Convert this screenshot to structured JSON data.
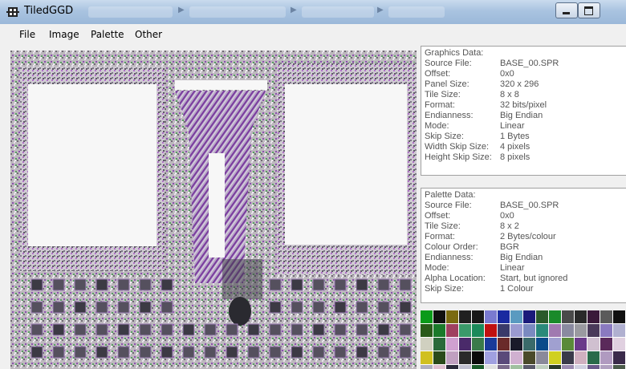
{
  "window": {
    "title": "TiledGGD"
  },
  "menu": [
    "File",
    "Image",
    "Palette",
    "Other"
  ],
  "graphics_panel": {
    "title": "Graphics Data:",
    "rows": [
      {
        "label": "Source File:",
        "value": "BASE_00.SPR"
      },
      {
        "label": "Offset:",
        "value": "0x0"
      },
      {
        "label": "Panel Size:",
        "value": "320 x 296"
      },
      {
        "label": "Tile Size:",
        "value": "8 x 8"
      },
      {
        "label": "Format:",
        "value": "32 bits/pixel"
      },
      {
        "label": "Endianness:",
        "value": "Big Endian"
      },
      {
        "label": "Mode:",
        "value": "Linear"
      },
      {
        "label": "Skip Size:",
        "value": "1 Bytes"
      },
      {
        "label": "Width Skip Size:",
        "value": "4 pixels"
      },
      {
        "label": "Height Skip Size:",
        "value": "8 pixels"
      }
    ]
  },
  "palette_panel": {
    "title": "Palette Data:",
    "rows": [
      {
        "label": "Source File:",
        "value": "BASE_00.SPR"
      },
      {
        "label": "Offset:",
        "value": "0x0"
      },
      {
        "label": "Tile Size:",
        "value": "8 x 2"
      },
      {
        "label": "Format:",
        "value": "2 Bytes/colour"
      },
      {
        "label": "Colour Order:",
        "value": "BGR"
      },
      {
        "label": "Endianness:",
        "value": "Big Endian"
      },
      {
        "label": "Mode:",
        "value": "Linear"
      },
      {
        "label": "Alpha Location:",
        "value": "Start, but ignored"
      },
      {
        "label": "Skip Size:",
        "value": "1 Colour"
      }
    ]
  },
  "palette_colors": [
    "#0a9a1a",
    "#101010",
    "#7a6a10",
    "#202020",
    "#181818",
    "#7a7ad0",
    "#1a2aa0",
    "#5a9ac0",
    "#1a1a7a",
    "#2a5a2a",
    "#1a8a2a",
    "#4a4a4a",
    "#2a2a2a",
    "#3a1a3a",
    "#5a5a5a",
    "#101010",
    "#2a5a1a",
    "#1a7a2a",
    "#a04060",
    "#3a9a6a",
    "#1a8a5a",
    "#c01010",
    "#3a3a6a",
    "#9a9ad0",
    "#7a8ac0",
    "#2a8a7a",
    "#a07ab0",
    "#8a8aa0",
    "#9a9aa0",
    "#4a3a5a",
    "#8a7ac0",
    "#b0b0d0",
    "#d0d0c0",
    "#2a6a3a",
    "#d0a0d0",
    "#4a2a6a",
    "#3a7a4a",
    "#1a3a9a",
    "#6a2a2a",
    "#1a1a2a",
    "#3a6a6a",
    "#0a4a8a",
    "#a0a0d0",
    "#5a8a3a",
    "#6a3a8a",
    "#d0c0d0",
    "#5a2a5a",
    "#e0d0e0",
    "#d0c020",
    "#2a4a1a",
    "#c0a0c0",
    "#2a2a2a",
    "#0a0a0a",
    "#a0a0e0",
    "#5a4a7a",
    "#d0b0d0",
    "#4a4a2a",
    "#8a8a9a",
    "#d0d020",
    "#3a3a4a",
    "#d0b0c0",
    "#2a6a4a",
    "#b09ac0",
    "#3a2a4a",
    "#b0b0c0",
    "#e0c0d0",
    "#2a2a3a",
    "#c0c0d0",
    "#1a5a2a",
    "#e0e0e0",
    "#7a6a8a",
    "#a0c0a0",
    "#5a5a6a",
    "#c0d0c0",
    "#2a3a2a",
    "#9a8ab0",
    "#d0d0e0",
    "#6a5a8a",
    "#b0a0c0",
    "#4a5a4a"
  ]
}
